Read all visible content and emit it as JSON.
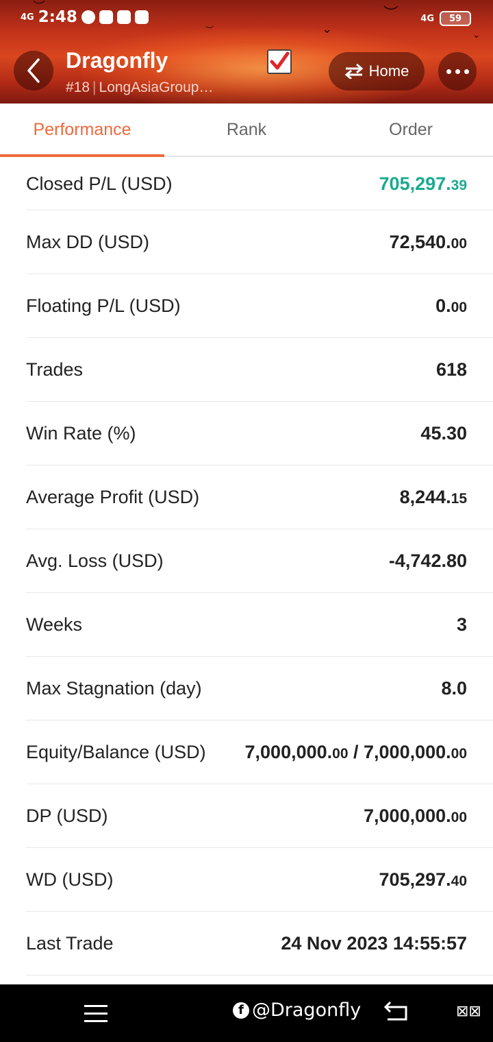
{
  "status_bar": {
    "signal": "4G",
    "time": "2:48",
    "network": "4G",
    "battery": "59"
  },
  "header": {
    "title": "Dragonfly",
    "rank_number": "#18",
    "broker": "LongAsiaGroup…",
    "home_label": "Home"
  },
  "tabs": [
    {
      "label": "Performance",
      "active": true
    },
    {
      "label": "Rank",
      "active": false
    },
    {
      "label": "Order",
      "active": false
    }
  ],
  "stats": [
    {
      "label": "Closed P/L (USD)",
      "value_main": "705,297.",
      "value_dec": "39",
      "highlight": "#1aaa8f"
    },
    {
      "label": "Max DD (USD)",
      "value_main": "72,540.",
      "value_dec": "00"
    },
    {
      "label": "Floating P/L (USD)",
      "value_main": "0.",
      "value_dec": "00"
    },
    {
      "label": "Trades",
      "value_main": "618",
      "value_dec": ""
    },
    {
      "label": "Win Rate (%)",
      "value_main": "45.30",
      "value_dec": ""
    },
    {
      "label": "Average Profit (USD)",
      "value_main": "8,244.",
      "value_dec": "15"
    },
    {
      "label": "Avg. Loss (USD)",
      "value_main": "-4,742.80",
      "value_dec": ""
    },
    {
      "label": "Weeks",
      "value_main": "3",
      "value_dec": ""
    },
    {
      "label": "Max Stagnation (day)",
      "value_main": "8.0",
      "value_dec": ""
    },
    {
      "label": "Equity/Balance (USD)",
      "value_main": "7,000,000.",
      "value_dec": "00",
      "value_sep": " / ",
      "value2_main": "7,000,000.",
      "value2_dec": "00"
    },
    {
      "label": "DP (USD)",
      "value_main": "7,000,000.",
      "value_dec": "00"
    },
    {
      "label": "WD (USD)",
      "value_main": "705,297.",
      "value_dec": "40"
    },
    {
      "label": "Last Trade",
      "value_main": "24 Nov 2023 14:55:57",
      "value_dec": ""
    }
  ],
  "nav_bar": {
    "watermark": "@Dragonfly",
    "extra": "⊠⊠"
  }
}
